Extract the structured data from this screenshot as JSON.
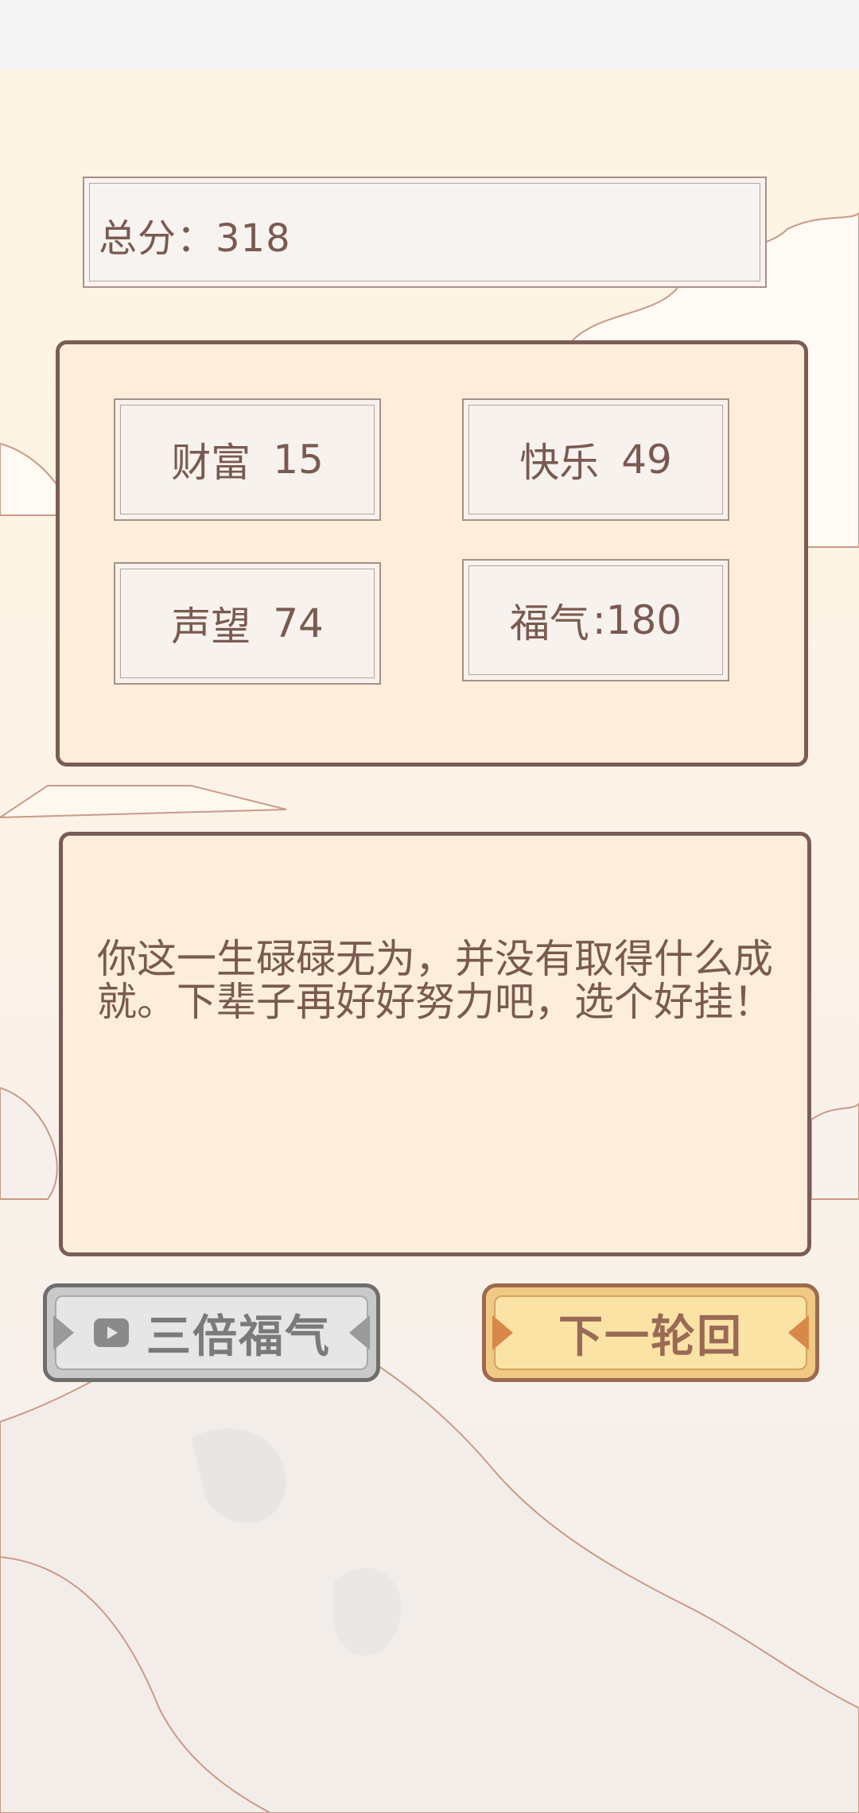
{
  "total": {
    "text": "总分：318"
  },
  "stats": [
    {
      "label": "财富",
      "value": "15"
    },
    {
      "label": "快乐",
      "value": "49"
    },
    {
      "label": "声望",
      "value": "74"
    },
    {
      "label": "福气",
      "value": ":180"
    }
  ],
  "message": {
    "text": "你这一生碌碌无为，并没有取得什么成就。下辈子再好好努力吧，选个好挂！"
  },
  "buttons": {
    "triple_label": "三倍福气",
    "next_label": "下一轮回"
  },
  "icons": {
    "triple_button": "video-icon"
  },
  "colors": {
    "panel_bg": "#fdeedb",
    "panel_border": "#7b5c55",
    "text": "#7a5a50",
    "next_button": "#fbe3a6",
    "triple_button": "#e6e6e6"
  }
}
